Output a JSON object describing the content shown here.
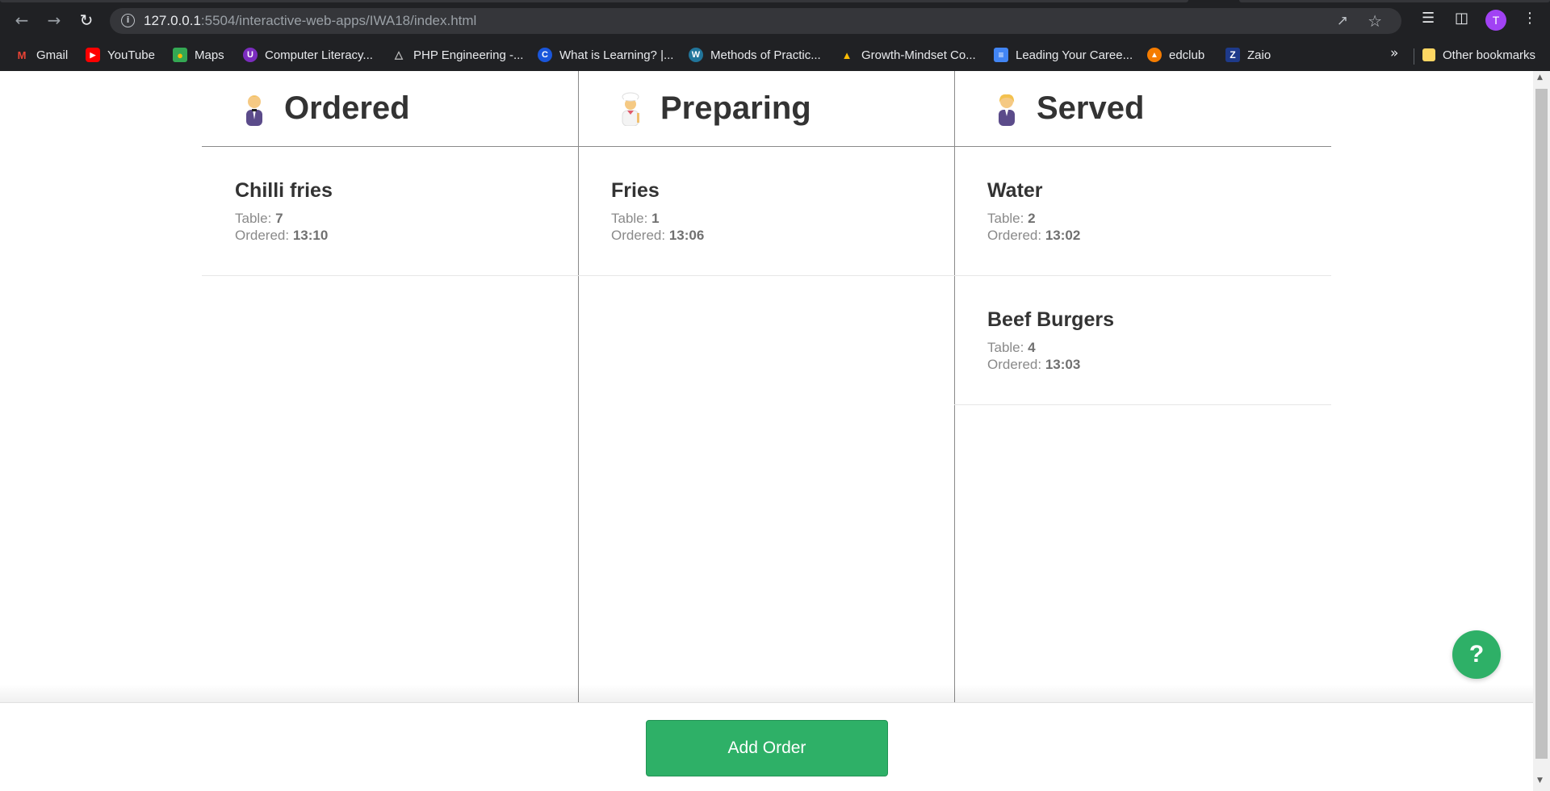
{
  "browser": {
    "url_host": "127.0.0.1",
    "url_rest": ":5504/interactive-web-apps/IWA18/index.html",
    "profile_initial": "T",
    "bookmarks": [
      {
        "label": "Gmail",
        "icon": "gmail-icon"
      },
      {
        "label": "YouTube",
        "icon": "youtube-icon"
      },
      {
        "label": "Maps",
        "icon": "maps-icon"
      },
      {
        "label": "Computer Literacy...",
        "icon": "literacy-icon"
      },
      {
        "label": "PHP Engineering -...",
        "icon": "triangle-icon"
      },
      {
        "label": "What is Learning? |...",
        "icon": "c-logo-icon"
      },
      {
        "label": "Methods of Practic...",
        "icon": "wordpress-icon"
      },
      {
        "label": "Growth-Mindset Co...",
        "icon": "google-drive-icon"
      },
      {
        "label": "Leading Your Caree...",
        "icon": "google-docs-icon"
      },
      {
        "label": "edclub",
        "icon": "edclub-icon"
      },
      {
        "label": "Zaio",
        "icon": "zaio-icon"
      }
    ],
    "other_bookmarks": "Other bookmarks"
  },
  "columns": [
    {
      "title": "Ordered",
      "emoji": "waiter-tuxedo-icon",
      "orders": [
        {
          "title": "Chilli fries",
          "table_label": "Table:",
          "table": "7",
          "ordered_label": "Ordered:",
          "time": "13:10"
        }
      ]
    },
    {
      "title": "Preparing",
      "emoji": "cook-icon",
      "orders": [
        {
          "title": "Fries",
          "table_label": "Table:",
          "table": "1",
          "ordered_label": "Ordered:",
          "time": "13:06"
        }
      ]
    },
    {
      "title": "Served",
      "emoji": "server-person-icon",
      "orders": [
        {
          "title": "Water",
          "table_label": "Table:",
          "table": "2",
          "ordered_label": "Ordered:",
          "time": "13:02"
        },
        {
          "title": "Beef Burgers",
          "table_label": "Table:",
          "table": "4",
          "ordered_label": "Ordered:",
          "time": "13:03"
        }
      ]
    }
  ],
  "footer": {
    "add_order_label": "Add Order"
  },
  "help": {
    "label": "?"
  },
  "colors": {
    "accent_green": "#2eb067",
    "text_dark": "#333333",
    "text_muted": "#8a8a8a"
  }
}
